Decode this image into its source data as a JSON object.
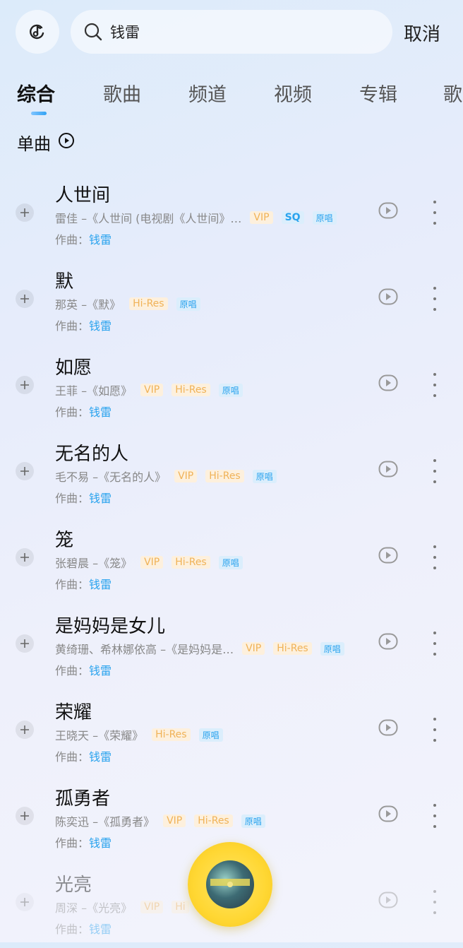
{
  "search": {
    "query": "钱雷",
    "cancel_label": "取消"
  },
  "tabs": [
    {
      "label": "综合",
      "active": true
    },
    {
      "label": "歌曲"
    },
    {
      "label": "频道"
    },
    {
      "label": "视频"
    },
    {
      "label": "专辑"
    },
    {
      "label": "歌"
    }
  ],
  "section": {
    "title": "单曲"
  },
  "composer_label": "作曲：",
  "songs": [
    {
      "title": "人世间",
      "artist_album": "雷佳 –《人世间 (电视剧《人世间》…",
      "tags": [
        "VIP",
        "SQ",
        "原唱"
      ],
      "composer": "钱雷"
    },
    {
      "title": "默",
      "artist_album": "那英 –《默》",
      "tags": [
        "Hi-Res",
        "原唱"
      ],
      "composer": "钱雷"
    },
    {
      "title": "如愿",
      "artist_album": "王菲 –《如愿》",
      "tags": [
        "VIP",
        "Hi-Res",
        "原唱"
      ],
      "composer": "钱雷"
    },
    {
      "title": "无名的人",
      "artist_album": "毛不易 –《无名的人》",
      "tags": [
        "VIP",
        "Hi-Res",
        "原唱"
      ],
      "composer": "钱雷"
    },
    {
      "title": "笼",
      "artist_album": "张碧晨 –《笼》",
      "tags": [
        "VIP",
        "Hi-Res",
        "原唱"
      ],
      "composer": "钱雷"
    },
    {
      "title": "是妈妈是女儿",
      "artist_album": "黄绮珊、希林娜依高 –《是妈妈是…",
      "tags": [
        "VIP",
        "Hi-Res",
        "原唱"
      ],
      "composer": "钱雷"
    },
    {
      "title": "荣耀",
      "artist_album": "王晓天 –《荣耀》",
      "tags": [
        "Hi-Res",
        "原唱"
      ],
      "composer": "钱雷"
    },
    {
      "title": "孤勇者",
      "artist_album": "陈奕迅 –《孤勇者》",
      "tags": [
        "VIP",
        "Hi-Res",
        "原唱"
      ],
      "composer": "钱雷"
    },
    {
      "title": "光亮",
      "artist_album": "周深 –《光亮》",
      "tags": [
        "VIP",
        "Hi"
      ],
      "composer": "钱雷"
    }
  ],
  "colors": {
    "accent": "#2aa3ee",
    "vip": "#f0b257",
    "player": "#ffd733"
  }
}
